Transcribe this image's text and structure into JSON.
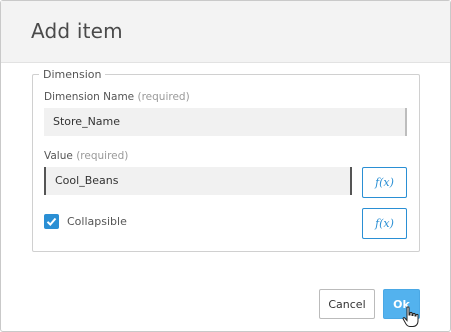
{
  "dialog": {
    "title": "Add item"
  },
  "section": {
    "legend": "Dimension"
  },
  "dimension_name": {
    "label": "Dimension Name",
    "required_hint": "(required)",
    "value": "Store_Name"
  },
  "value_field": {
    "label": "Value",
    "required_hint": "(required)",
    "value": "Cool_Beans",
    "fx_label": "f(x)"
  },
  "collapsible": {
    "label": "Collapsible",
    "checked": true,
    "fx_label": "f(x)"
  },
  "footer": {
    "cancel_label": "Cancel",
    "ok_label": "Ok"
  },
  "colors": {
    "accent": "#2a8fd4",
    "ok_button": "#53b2ee",
    "header_bg": "#f3f3f3",
    "input_bg": "#f1f1f1"
  },
  "icons": {
    "checkbox": "checkmark-icon",
    "cursor": "hand-pointer-icon"
  }
}
